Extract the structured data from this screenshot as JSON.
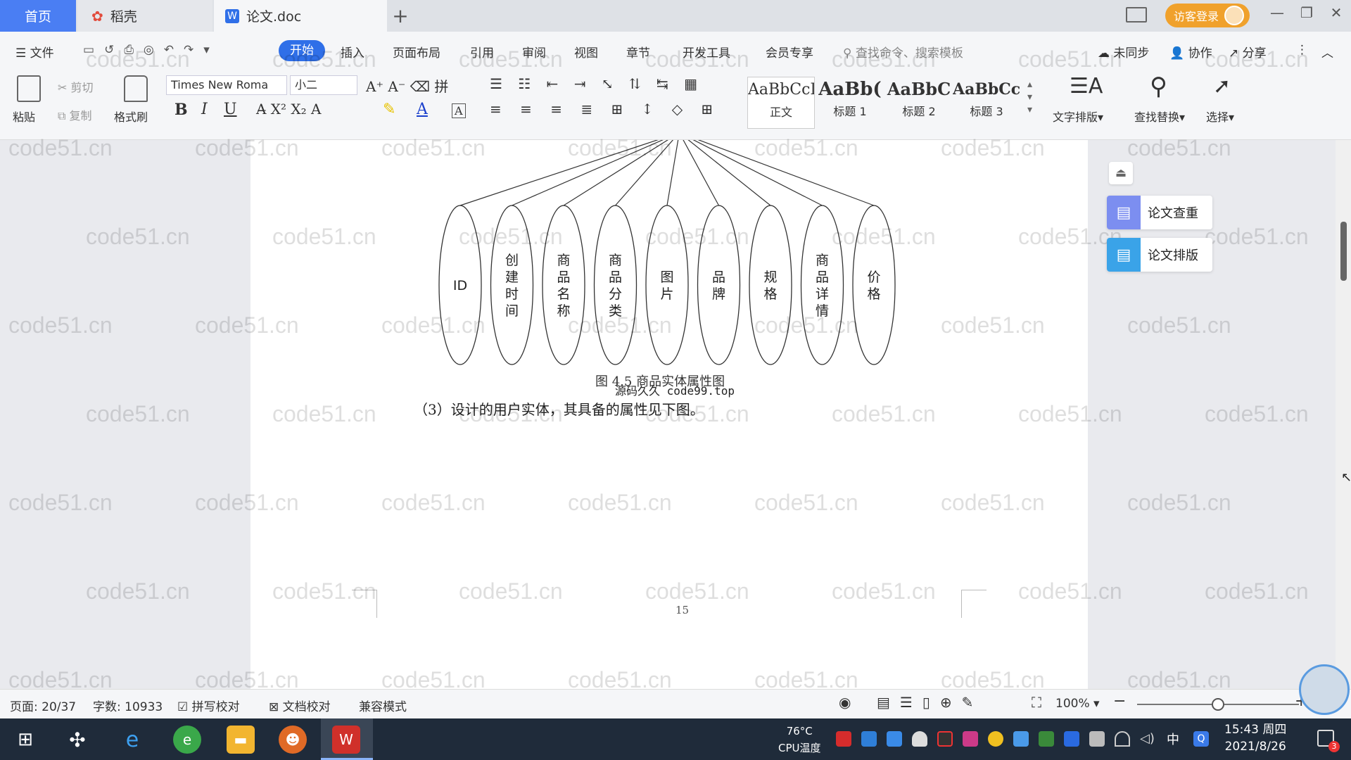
{
  "tabs": {
    "home": "首页",
    "daoke": "稻壳",
    "doc": "论文.doc",
    "add": "+"
  },
  "window": {
    "login": "访客登录",
    "minimize": "—",
    "restore": "❐",
    "close": "✕"
  },
  "menu": {
    "file": "文件",
    "start": "开始",
    "items": [
      "插入",
      "页面布局",
      "引用",
      "审阅",
      "视图",
      "章节",
      "开发工具",
      "会员专享"
    ],
    "search_placeholder": "查找命令、搜索模板",
    "unsynced": "未同步",
    "collab": "协作",
    "share": "分享"
  },
  "ribbon": {
    "paste": "粘贴",
    "cut": "剪切",
    "copy": "复制",
    "format_painter": "格式刷",
    "font_name": "Times New Roma",
    "font_size": "小二",
    "bold": "B",
    "italic": "I",
    "underline": "U",
    "styles": [
      {
        "sample": "AaBbCcI",
        "name": "正文"
      },
      {
        "sample": "AaBb(",
        "name": "标题 1"
      },
      {
        "sample": "AaBbC",
        "name": "标题 2"
      },
      {
        "sample": "AaBbCcl",
        "name": "标题 3"
      }
    ],
    "text_layout": "文字排版",
    "find_replace": "查找替换",
    "select": "选择"
  },
  "document": {
    "attributes": [
      "ID",
      "创建时间",
      "商品名称",
      "商品分类",
      "图片",
      "品牌",
      "规格",
      "商品详情",
      "价格"
    ],
    "caption": "图 4.5 商品实体属性图",
    "overlay": "源码久久 code99.top",
    "paragraph": "（3）设计的用户实体，其具备的属性见下图。",
    "page_number": "15",
    "watermark": "code51.cn"
  },
  "side_panel": {
    "check": "论文查重",
    "layout": "论文排版"
  },
  "status": {
    "page": "页面: 20/37",
    "words": "字数: 10933",
    "spell": "拼写校对",
    "proof": "文档校对",
    "compat": "兼容模式",
    "zoom": "100%",
    "zoom_level": 0.5
  },
  "taskbar": {
    "temp": "76°C",
    "cpu": "CPU温度",
    "ime": "中",
    "time": "15:43 周四",
    "date": "2021/8/26",
    "notify_count": "3"
  },
  "colors": {
    "accent": "#2f6fe8",
    "login": "#f0a12c",
    "taskbar": "#1f2b3a"
  }
}
